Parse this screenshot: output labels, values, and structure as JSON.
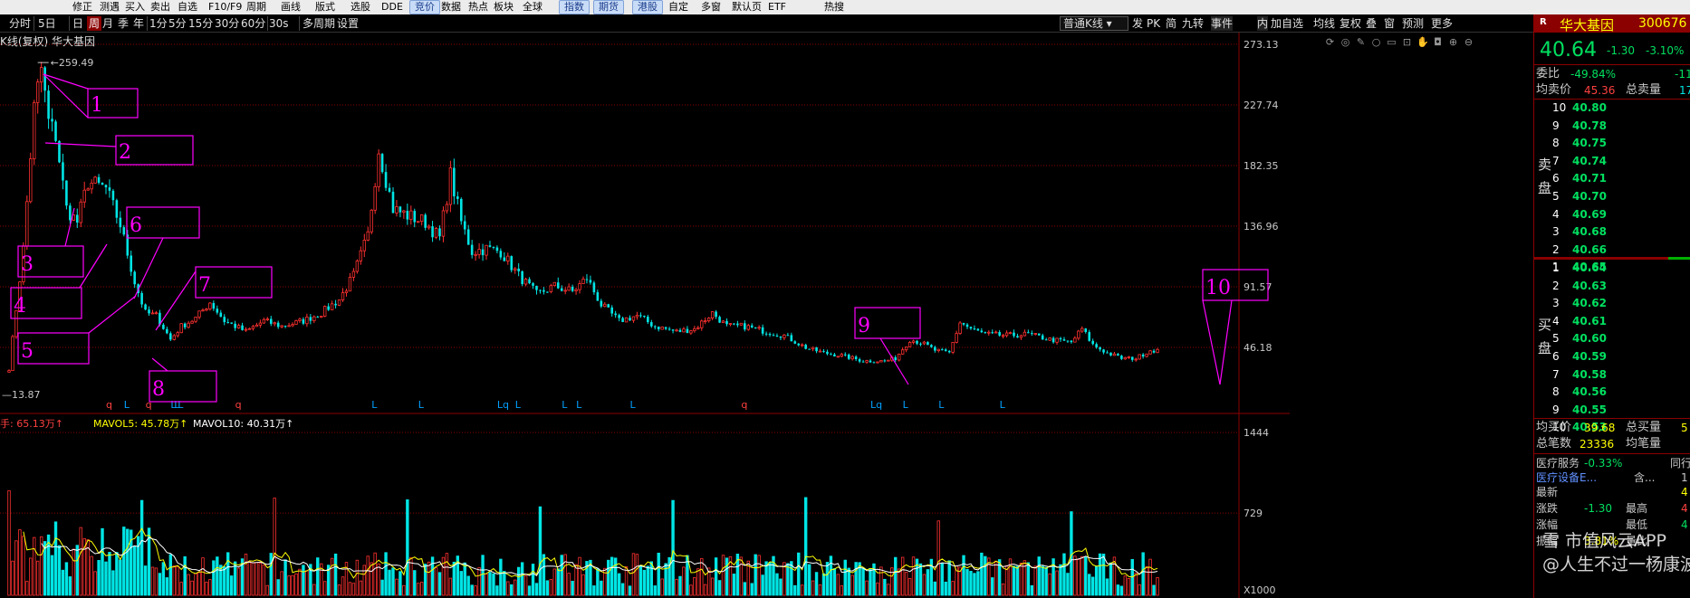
{
  "menubar": {
    "items": [
      "修正",
      "测遇",
      "买入",
      "卖出",
      "自选",
      "F10/F9",
      "周期",
      "画线",
      "版式",
      "选股",
      "DDE",
      "竞价",
      "数据",
      "热点",
      "板块",
      "全球",
      "指数",
      "期货",
      "港股",
      "自定",
      "多窗",
      "默认页",
      "ETF",
      "热搜"
    ],
    "blue_items": [
      "竞价",
      "指数",
      "期货",
      "港股"
    ]
  },
  "toolbar": {
    "periods": [
      "分时",
      "5日",
      "日",
      "周",
      "月",
      "季",
      "年",
      "1分",
      "5分",
      "15分",
      "30分",
      "60分",
      "30s",
      "多周期",
      "设置"
    ],
    "selected_period": "周",
    "right_buttons": [
      "发",
      "PK",
      "简",
      "九转",
      "事件",
      "内",
      "加自选",
      "均线",
      "复权",
      "叠",
      "窗",
      "预测",
      "更多"
    ],
    "kline_type": "普通K线"
  },
  "chart_header": {
    "title": "K线(复权) 华大基因"
  },
  "panel": {
    "logo": "R",
    "name": "华大基因",
    "code": "300676",
    "price": "40.64",
    "change": "-1.30",
    "change_pct": "-3.10%",
    "weibi_label": "委比",
    "weibi": "-49.84%",
    "weibi_extra": "-11",
    "avg_ask_label": "均卖价",
    "avg_ask": "45.36",
    "total_ask_label": "总卖量",
    "total_ask": "17",
    "sell_label": [
      "卖",
      "盘"
    ],
    "buy_label": [
      "买",
      "盘"
    ],
    "sell": [
      {
        "level": "10",
        "price": "40.80"
      },
      {
        "level": "9",
        "price": "40.78"
      },
      {
        "level": "8",
        "price": "40.75"
      },
      {
        "level": "7",
        "price": "40.74"
      },
      {
        "level": "6",
        "price": "40.71"
      },
      {
        "level": "5",
        "price": "40.70"
      },
      {
        "level": "4",
        "price": "40.69"
      },
      {
        "level": "3",
        "price": "40.68"
      },
      {
        "level": "2",
        "price": "40.66"
      },
      {
        "level": "1",
        "price": "40.65"
      }
    ],
    "buy": [
      {
        "level": "1",
        "price": "40.64"
      },
      {
        "level": "2",
        "price": "40.63"
      },
      {
        "level": "3",
        "price": "40.62"
      },
      {
        "level": "4",
        "price": "40.61"
      },
      {
        "level": "5",
        "price": "40.60"
      },
      {
        "level": "6",
        "price": "40.59"
      },
      {
        "level": "7",
        "price": "40.58"
      },
      {
        "level": "8",
        "price": "40.56"
      },
      {
        "level": "9",
        "price": "40.55"
      },
      {
        "level": "10",
        "price": "40.53"
      }
    ],
    "avg_bid_label": "均买价",
    "avg_bid": "39.68",
    "total_bid_label": "总买量",
    "total_bid": "5",
    "trades_label": "总笔数",
    "trades": "23336",
    "avg_trade_label": "均笔量",
    "sector_label": "医疗服务",
    "sector_pct": "-0.33%",
    "peers_label": "同行",
    "sector2_label": "医疗设备E...",
    "sector2_val": "含...",
    "sector2_num": "1",
    "row_a_label": "最新",
    "row_a_right": "4",
    "row_b_label": "涨跌",
    "row_b_val": "-1.30",
    "row_b_mid": "最高",
    "row_b_right": "4",
    "row_c_label": "涨幅",
    "row_c_mid": "最低",
    "row_c_right": "4",
    "row_d_label": "振幅",
    "row_d_val": "3.81%",
    "row_d_mid": "量比"
  },
  "watermark": {
    "line1": "雪 市值风云APP",
    "line2": "@人生不过一杨康波"
  },
  "chart_data": [
    {
      "type": "candlestick",
      "title": "K线(复权) 华大基因",
      "period": "周",
      "ylim": [
        0,
        273.13
      ],
      "y_ticks": [
        "273.13",
        "227.74",
        "182.35",
        "136.96",
        "91.57",
        "46.18"
      ],
      "y_tick_values": [
        273.13,
        227.74,
        182.35,
        136.96,
        91.57,
        46.18
      ],
      "max_label": "259.49",
      "min_label": "13.87",
      "close_trend": [
        {
          "x": 0,
          "v": 30
        },
        {
          "x": 4,
          "v": 120
        },
        {
          "x": 7,
          "v": 225
        },
        {
          "x": 9,
          "v": 255
        },
        {
          "x": 11,
          "v": 215
        },
        {
          "x": 13,
          "v": 205
        },
        {
          "x": 16,
          "v": 150
        },
        {
          "x": 19,
          "v": 140
        },
        {
          "x": 22,
          "v": 170
        },
        {
          "x": 27,
          "v": 165
        },
        {
          "x": 31,
          "v": 138
        },
        {
          "x": 35,
          "v": 95
        },
        {
          "x": 38,
          "v": 72
        },
        {
          "x": 41,
          "v": 70
        },
        {
          "x": 45,
          "v": 52
        },
        {
          "x": 48,
          "v": 62
        },
        {
          "x": 52,
          "v": 68
        },
        {
          "x": 56,
          "v": 80
        },
        {
          "x": 60,
          "v": 66
        },
        {
          "x": 66,
          "v": 58
        },
        {
          "x": 71,
          "v": 66
        },
        {
          "x": 76,
          "v": 62
        },
        {
          "x": 82,
          "v": 66
        },
        {
          "x": 87,
          "v": 72
        },
        {
          "x": 92,
          "v": 82
        },
        {
          "x": 96,
          "v": 100
        },
        {
          "x": 100,
          "v": 130
        },
        {
          "x": 103,
          "v": 195
        },
        {
          "x": 107,
          "v": 150
        },
        {
          "x": 111,
          "v": 145
        },
        {
          "x": 116,
          "v": 140
        },
        {
          "x": 120,
          "v": 128
        },
        {
          "x": 123,
          "v": 175
        },
        {
          "x": 126,
          "v": 140
        },
        {
          "x": 129,
          "v": 118
        },
        {
          "x": 133,
          "v": 120
        },
        {
          "x": 137,
          "v": 118
        },
        {
          "x": 142,
          "v": 100
        },
        {
          "x": 147,
          "v": 86
        },
        {
          "x": 152,
          "v": 92
        },
        {
          "x": 157,
          "v": 88
        },
        {
          "x": 161,
          "v": 98
        },
        {
          "x": 165,
          "v": 78
        },
        {
          "x": 170,
          "v": 66
        },
        {
          "x": 175,
          "v": 70
        },
        {
          "x": 180,
          "v": 62
        },
        {
          "x": 186,
          "v": 58
        },
        {
          "x": 191,
          "v": 60
        },
        {
          "x": 196,
          "v": 72
        },
        {
          "x": 200,
          "v": 62
        },
        {
          "x": 205,
          "v": 62
        },
        {
          "x": 211,
          "v": 58
        },
        {
          "x": 216,
          "v": 55
        },
        {
          "x": 222,
          "v": 46
        },
        {
          "x": 227,
          "v": 42
        },
        {
          "x": 232,
          "v": 40
        },
        {
          "x": 238,
          "v": 36
        },
        {
          "x": 244,
          "v": 36
        },
        {
          "x": 247,
          "v": 38
        },
        {
          "x": 251,
          "v": 52
        },
        {
          "x": 254,
          "v": 50
        },
        {
          "x": 258,
          "v": 44
        },
        {
          "x": 262,
          "v": 42
        },
        {
          "x": 265,
          "v": 65
        },
        {
          "x": 268,
          "v": 60
        },
        {
          "x": 272,
          "v": 56
        },
        {
          "x": 278,
          "v": 55
        },
        {
          "x": 284,
          "v": 56
        },
        {
          "x": 290,
          "v": 52
        },
        {
          "x": 296,
          "v": 50
        },
        {
          "x": 299,
          "v": 60
        },
        {
          "x": 302,
          "v": 48
        },
        {
          "x": 306,
          "v": 42
        },
        {
          "x": 310,
          "v": 38
        },
        {
          "x": 314,
          "v": 38
        },
        {
          "x": 318,
          "v": 44
        }
      ],
      "annotations": [
        {
          "label": "1",
          "x": 9,
          "v": 259.49
        },
        {
          "label": "2",
          "x": 12,
          "v": 207
        },
        {
          "label": "3",
          "x": 17,
          "v": 138
        },
        {
          "label": "4",
          "x": 28,
          "v": 130
        },
        {
          "label": "5",
          "x": 33,
          "v": 96
        },
        {
          "label": "6",
          "x": 34,
          "v": 102
        },
        {
          "label": "7",
          "x": 38,
          "v": 70
        },
        {
          "label": "8",
          "x": 42,
          "v": 58
        },
        {
          "label": "9",
          "x": 226,
          "v": 40
        },
        {
          "label": "10",
          "x": 307,
          "v": 37
        }
      ],
      "event_markers": [
        {
          "x": 27,
          "t": "q"
        },
        {
          "x": 32,
          "t": "L"
        },
        {
          "x": 38,
          "t": "q"
        },
        {
          "x": 45,
          "t": "L"
        },
        {
          "x": 46,
          "t": "L"
        },
        {
          "x": 47,
          "t": "L"
        },
        {
          "x": 63,
          "t": "q"
        },
        {
          "x": 101,
          "t": "L"
        },
        {
          "x": 114,
          "t": "L"
        },
        {
          "x": 136,
          "t": "Lq"
        },
        {
          "x": 141,
          "t": "L"
        },
        {
          "x": 154,
          "t": "L"
        },
        {
          "x": 158,
          "t": "L"
        },
        {
          "x": 173,
          "t": "L"
        },
        {
          "x": 204,
          "t": "q"
        },
        {
          "x": 240,
          "t": "Lq"
        },
        {
          "x": 249,
          "t": "L"
        },
        {
          "x": 259,
          "t": "L"
        },
        {
          "x": 276,
          "t": "L"
        }
      ]
    },
    {
      "type": "bar",
      "title": "",
      "legend": [
        {
          "name": "成交手",
          "value": "65.13万↑",
          "color": "#ff4040"
        },
        {
          "name": "MAVOL5",
          "value": "45.78万↑",
          "color": "#ffff00"
        },
        {
          "name": "MAVOL10",
          "value": "40.31万↑",
          "color": "#ffffff"
        }
      ],
      "legend_text": "手: 65.13万↑  MAVOL5: 45.78万↑  MAVOL10: 40.31万↑",
      "y_ticks": [
        "1444",
        "729"
      ],
      "y_tick_values": [
        1444,
        729
      ],
      "unit_label": "X1000",
      "ylim": [
        0,
        1444
      ]
    }
  ],
  "colors": {
    "up": "#ff3030",
    "down": "#00e5e5",
    "grid": "#8b0000",
    "annotation": "#ff00ff",
    "marker": "#c0c0c0"
  }
}
